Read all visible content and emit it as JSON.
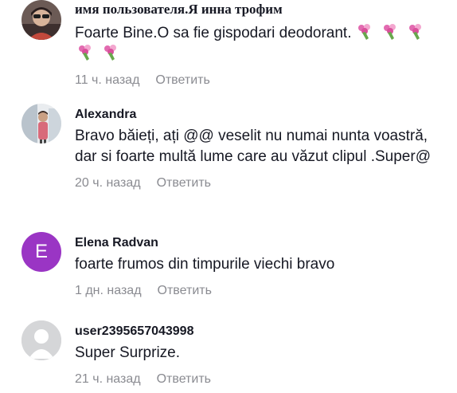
{
  "comments": [
    {
      "username": "имя пользователя.Я инна трофим",
      "text": "Foarte Bine.O sa fie gispodari deodorant.",
      "emoji": "bouquet-icon",
      "emoji_count": 5,
      "time": "11 ч. назад",
      "reply": "Ответить",
      "avatar": "photo"
    },
    {
      "username": "Alexandra",
      "text": "Bravo băieți, ați @@ veselit nu numai nunta voastră, dar si foarte multă lume care au văzut clipul .Super@",
      "time": "20 ч. назад",
      "reply": "Ответить",
      "avatar": "photo"
    },
    {
      "username": "Elena Radvan",
      "text": "foarte frumos din timpurile viechi bravo",
      "time": "1 дн. назад",
      "reply": "Ответить",
      "avatar_letter": "E",
      "avatar_color": "#9a35c4"
    },
    {
      "username": "user2395657043998",
      "text": "Super Surprize.",
      "time": "21 ч. назад",
      "reply": "Ответить",
      "avatar": "default"
    }
  ]
}
